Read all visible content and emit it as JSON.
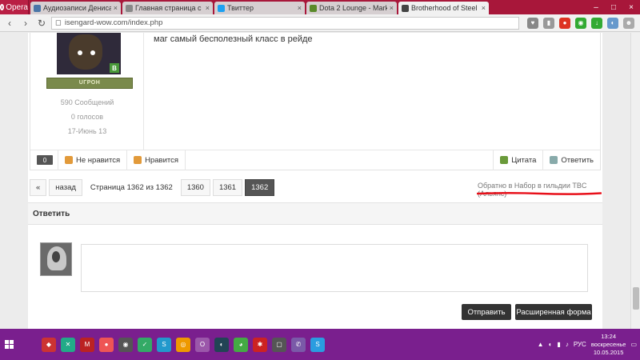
{
  "browser": {
    "menu_label": "Opera",
    "tabs": [
      {
        "label": "Аудиозаписи Дениса Зах",
        "color": "#4a76a8"
      },
      {
        "label": "Главная страница с DOTA",
        "color": "#888888"
      },
      {
        "label": "Твиттер",
        "color": "#1da1f2"
      },
      {
        "label": "Dota 2 Lounge - Marketpl",
        "color": "#5a8a2a"
      },
      {
        "label": "Brotherhood of Steel - Cry",
        "color": "#444444"
      }
    ],
    "url": "isengard-wow.com/index.php"
  },
  "post": {
    "user_title": "UГРОН",
    "rank_badge": "B",
    "message_count": "590 Сообщений",
    "votes": "0 голосов",
    "join_date": "17-Июнь 13",
    "message": "маг самый бесполезный класс в рейде",
    "score": "0",
    "dislike_label": "Не нравится",
    "like_label": "Нравится",
    "quote_label": "Цитата",
    "reply_label": "Ответить"
  },
  "pager": {
    "first": "«",
    "back": "назад",
    "status": "Страница 1362 из 1362",
    "pages": [
      "1360",
      "1361",
      "1362"
    ],
    "back_link": "Обратно в Набор в гильдии TBC (Альянс)"
  },
  "reply": {
    "heading": "Ответить",
    "send_label": "Отправить",
    "advanced_label": "Расширенная форма"
  },
  "taskbar": {
    "lang": "РУС",
    "time": "13:24",
    "day": "воскресенье",
    "date": "10.05.2015"
  }
}
